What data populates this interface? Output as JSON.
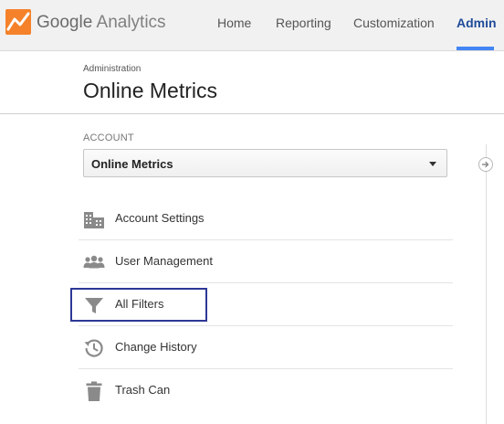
{
  "header": {
    "brand_google": "Google",
    "brand_product": "Analytics",
    "nav": [
      {
        "label": "Home",
        "active": false
      },
      {
        "label": "Reporting",
        "active": false
      },
      {
        "label": "Customization",
        "active": false
      },
      {
        "label": "Admin",
        "active": true
      }
    ],
    "logo_icon": "analytics-logo-icon"
  },
  "page": {
    "breadcrumb": "Administration",
    "title": "Online Metrics"
  },
  "account": {
    "section_label": "ACCOUNT",
    "selected": "Online Metrics"
  },
  "menu": {
    "items": [
      {
        "label": "Account Settings",
        "icon": "building-icon"
      },
      {
        "label": "User Management",
        "icon": "users-icon"
      },
      {
        "label": "All Filters",
        "icon": "filter-icon",
        "highlighted": true
      },
      {
        "label": "Change History",
        "icon": "history-icon"
      },
      {
        "label": "Trash Can",
        "icon": "trash-icon"
      }
    ]
  },
  "colors": {
    "active_nav": "#1f4b99",
    "active_underline": "#4285f4",
    "logo_orange": "#f5822a",
    "highlight_border": "#2e3796",
    "icon_gray": "#8a8a8a"
  }
}
